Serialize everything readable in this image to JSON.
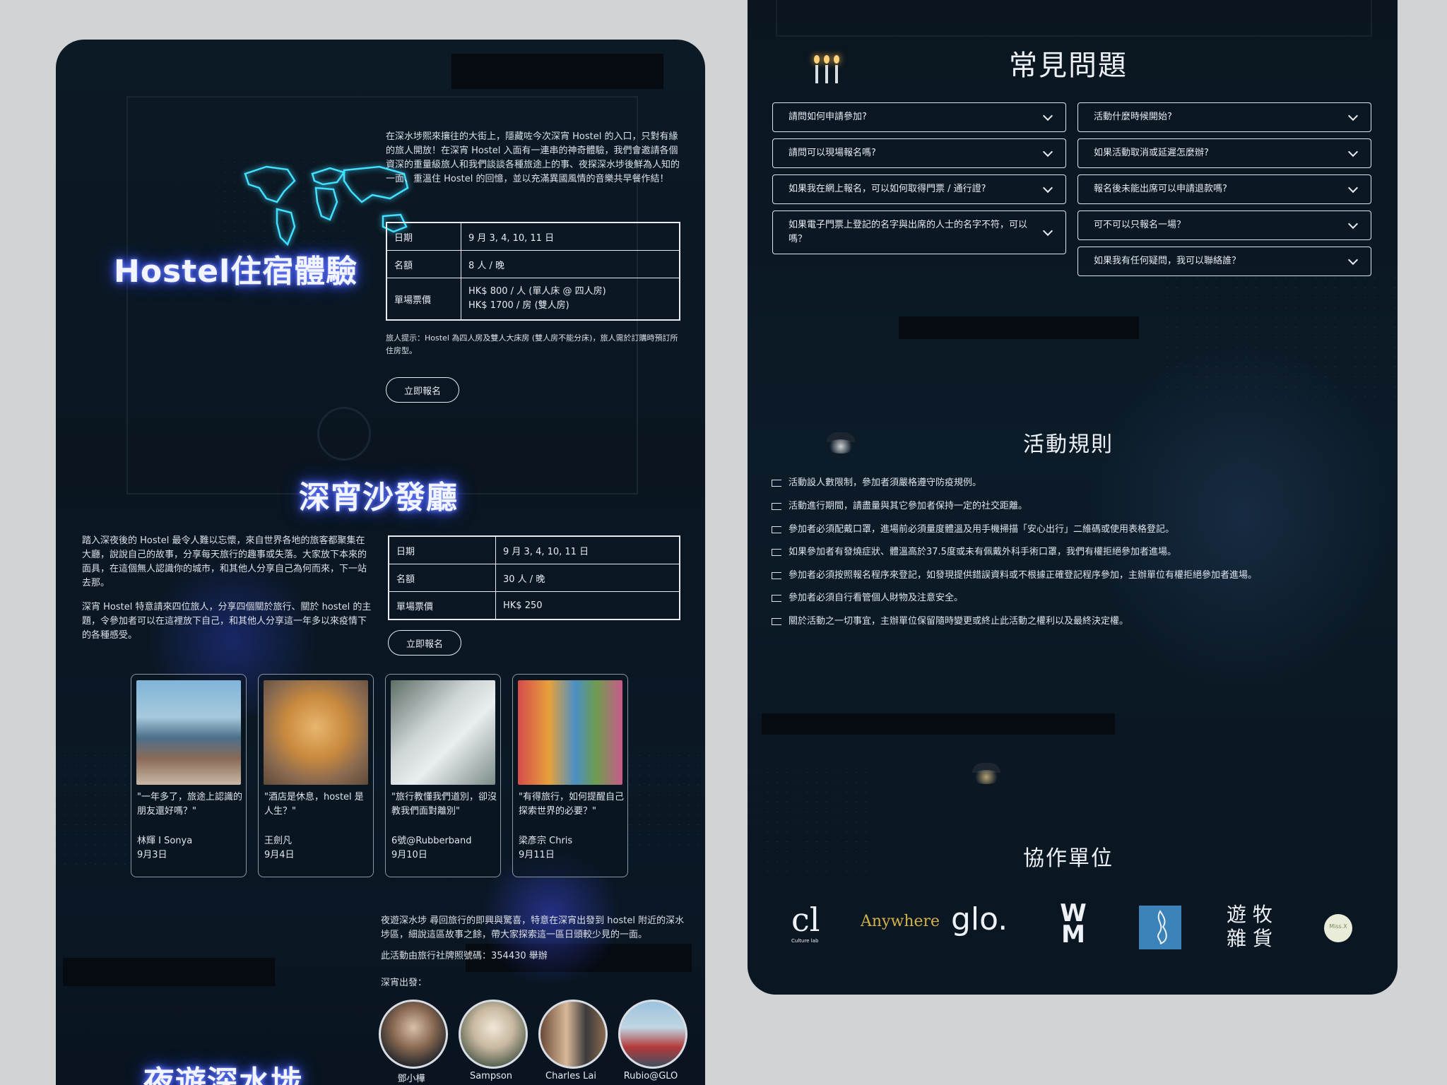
{
  "hostel": {
    "title": "Hostel住宿體驗",
    "intro": "在深水埗熙來攘往的大街上，隱藏咗今次深宵 Hostel 的入口，只對有緣的旅人開放！在深宵 Hostel 入面有一連串的神奇體驗，我們會邀請各個資深的重量級旅人和我們談談各種旅途上的事、夜探深水埗後鮮為人知的一面、重溫住 Hostel 的回憶，並以充滿異國風情的音樂共早餐作結！",
    "table": [
      {
        "k": "日期",
        "v": "9 月 3, 4, 10, 11 日"
      },
      {
        "k": "名額",
        "v": "8 人 / 晚"
      },
      {
        "k": "單場票價",
        "v": "HK$ 800 / 人 (單人床 @ 四人房)",
        "v2": "HK$ 1700 / 房 (雙人房)"
      }
    ],
    "note": "旅人提示：Hostel 為四人房及雙人大床房 (雙人房不能分床)，旅人需於訂購時預訂所住房型。",
    "button": "立即報名"
  },
  "sofa": {
    "title": "深宵沙發廳",
    "para1": "踏入深夜後的 Hostel 最令人難以忘懷，來自世界各地的旅客都聚集在大廳，說說自己的故事，分享每天旅行的趣事或失落。大家放下本來的面具，在這個無人認識你的城市，和其他人分享自己為何而來，下一站去那。",
    "para2": "深宵 Hostel 特意請來四位旅人，分享四個關於旅行、關於 hostel 的主題，令參加者可以在這裡放下自己，和其他人分享這一年多以來疫情下的各種感受。",
    "table": [
      {
        "k": "日期",
        "v": "9 月 3, 4, 10, 11 日"
      },
      {
        "k": "名額",
        "v": "30 人 / 晚"
      },
      {
        "k": "單場票價",
        "v": "HK$ 250"
      }
    ],
    "button": "立即報名",
    "cards": [
      {
        "quote": "\"一年多了，旅途上認識的朋友還好嗎？\"",
        "name": "林輝 I Sonya",
        "date": "9月3日"
      },
      {
        "quote": "\"酒店是休息，hostel 是人生？\"",
        "name": "王劍凡",
        "date": "9月4日"
      },
      {
        "quote": "\"旅行教懂我們道別，卻沒教我們面對離別\"",
        "name": "6號@Rubberband",
        "date": "9月10日"
      },
      {
        "quote": "\"有得旅行，如何提醒自己探索世界的必要？\"",
        "name": "梁彥宗 Chris",
        "date": "9月11日"
      }
    ]
  },
  "night": {
    "para": "夜遊深水埗 尋回旅行的即興與驚喜，特意在深宵出發到 hostel 附近的深水埗區，細說這區故事之餘，帶大家探索這一區日頭較少見的一面。",
    "license": "此活動由旅行社牌照號碼：354430 舉辦",
    "depart": "深宵出發：",
    "guides": [
      "鄧小樺",
      "Sampson",
      "Charles Lai",
      "Rubio@GLO"
    ],
    "title": "夜遊深水埗"
  },
  "faq": {
    "title": "常見問題",
    "left": [
      "請問如何申請參加?",
      "請問可以現場報名嗎?",
      "如果我在網上報名，可以如何取得門票 / 通行證?",
      "如果電子門票上登記的名字與出席的人士的名字不符，可以嗎？"
    ],
    "right": [
      "活動什麼時候開始?",
      "如果活動取消或延遲怎麼辦?",
      "報名後未能出席可以申請退款嗎?",
      "可不可以只報名一場？",
      "如果我有任何疑問，我可以聯絡誰？"
    ]
  },
  "rules": {
    "title": "活動規則",
    "items": [
      "活動設人數限制，參加者須嚴格遵守防疫規例。",
      "活動進行期間，請盡量與其它參加者保持一定的社交距離。",
      "參加者必須配戴口罩，進場前必須量度體溫及用手機掃描「安心出行」二維碼或使用表格登記。",
      "如果參加者有發燒症狀、體溫高於37.5度或未有佩戴外科手術口罩，我們有權拒絕參加者進場。",
      "參加者必須按照報名程序來登記，如發現提供錯誤資料或不根據正確登記程序參加，主辦單位有權拒絕參加者進場。",
      "參加者必須自行看管個人財物及注意安全。",
      "關於活動之一切事宜，主辦單位保留隨時變更或終止此活動之權利以及最終決定權。"
    ]
  },
  "partners": {
    "title": "協作單位",
    "cl_sub": "Culture lab",
    "anywhere": "Anywhere",
    "glo": "glo.",
    "wm": "W M",
    "youmu1": "遊 牧",
    "youmu2": "雜 貨",
    "missx": "Miss.X"
  },
  "colors": {
    "panel": "#0b1723",
    "neon": "#4b63ff",
    "mapNeon": "#41e0ff",
    "outside": "#d2d3d5"
  }
}
